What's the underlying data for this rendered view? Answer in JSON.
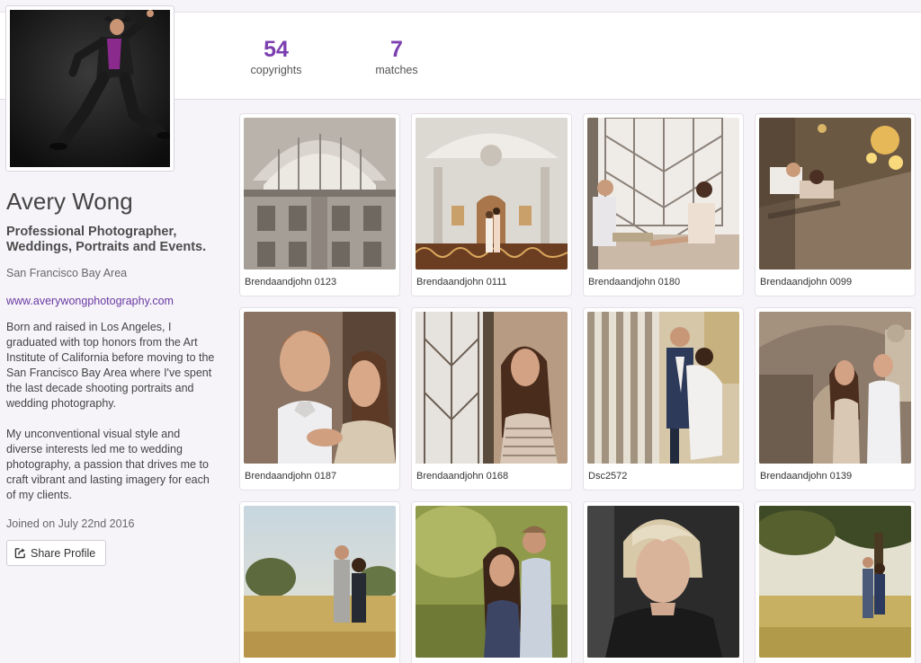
{
  "profile": {
    "name": "Avery Wong",
    "headline": "Professional Photographer, Weddings, Portraits and Events.",
    "location": "San Francisco Bay Area",
    "website": "www.averywongphotography.com",
    "bio": [
      "Born and raised in Los Angeles, I graduated with top honors from the Art Institute of California before moving to the San Francisco Bay Area where I've spent the last decade shooting portraits and wedding photography.",
      "My unconventional visual style and diverse interests led me to wedding photography, a passion that drives me to craft vibrant and lasting imagery for each of my clients."
    ],
    "joined": "Joined on July 22nd 2016",
    "share_label": "Share Profile"
  },
  "stats": {
    "copyrights": {
      "value": "54",
      "label": "copyrights"
    },
    "matches": {
      "value": "7",
      "label": "matches"
    }
  },
  "photos": [
    {
      "caption": "Brendaandjohn 0123",
      "icon": "architecture-photo"
    },
    {
      "caption": "Brendaandjohn 0111",
      "icon": "hall-couple-photo"
    },
    {
      "caption": "Brendaandjohn 0180",
      "icon": "window-couple-photo"
    },
    {
      "caption": "Brendaandjohn 0099",
      "icon": "chandelier-couple-photo"
    },
    {
      "caption": "Brendaandjohn 0187",
      "icon": "couple-closeup-photo"
    },
    {
      "caption": "Brendaandjohn 0168",
      "icon": "woman-window-photo"
    },
    {
      "caption": "Dsc2572",
      "icon": "couple-railing-photo"
    },
    {
      "caption": "Brendaandjohn 0139",
      "icon": "couple-arch-photo"
    },
    {
      "caption": "",
      "icon": "field-couple-photo"
    },
    {
      "caption": "",
      "icon": "meadow-couple-photo"
    },
    {
      "caption": "",
      "icon": "woman-portrait-photo"
    },
    {
      "caption": "",
      "icon": "tree-couple-photo"
    }
  ],
  "colors": {
    "accent": "#7b3fb0",
    "link": "#6a3aa2",
    "background": "#f6f4f9"
  }
}
